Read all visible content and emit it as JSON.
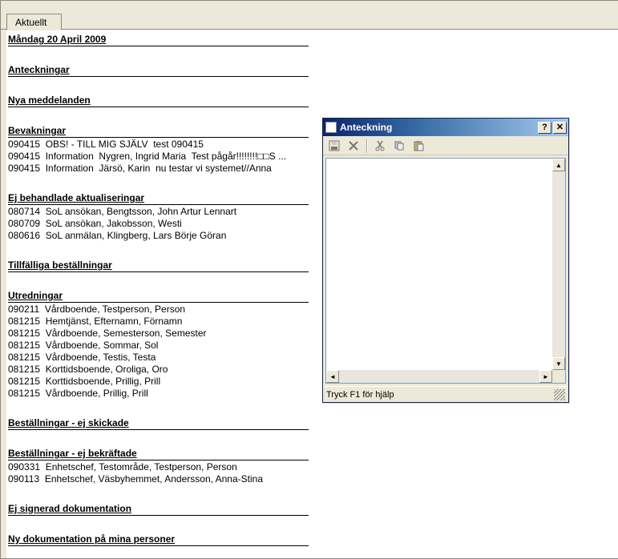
{
  "tab": {
    "label": "Aktuellt"
  },
  "date_heading": "Måndag 20 April 2009",
  "sections": {
    "anteckningar": {
      "title": "Anteckningar"
    },
    "nya_meddelanden": {
      "title": "Nya meddelanden"
    },
    "bevakningar": {
      "title": "Bevakningar",
      "items": [
        {
          "date": "090415",
          "text": "OBS! - TILL MIG SJÄLV  test 090415"
        },
        {
          "date": "090415",
          "text": "Information  Nygren, Ingrid Maria  Test pågår!!!!!!!!□□S ..."
        },
        {
          "date": "090415",
          "text": "Information  Järsö, Karin  nu testar vi systemet//Anna"
        }
      ]
    },
    "ej_behandlade": {
      "title": "Ej behandlade aktualiseringar",
      "items": [
        {
          "date": "080714",
          "text": "SoL ansökan, Bengtsson, John Artur Lennart"
        },
        {
          "date": "080709",
          "text": "SoL ansökan, Jakobsson, Westi"
        },
        {
          "date": "080616",
          "text": "SoL anmälan, Klingberg, Lars Börje Göran"
        }
      ]
    },
    "tillfalliga": {
      "title": "Tillfälliga beställningar"
    },
    "utredningar": {
      "title": "Utredningar",
      "items": [
        {
          "date": "090211",
          "text": "Vårdboende, Testperson, Person"
        },
        {
          "date": "081215",
          "text": "Hemtjänst, Efternamn, Förnamn"
        },
        {
          "date": "081215",
          "text": "Vårdboende, Semesterson, Semester"
        },
        {
          "date": "081215",
          "text": "Vårdboende, Sommar, Sol"
        },
        {
          "date": "081215",
          "text": "Vårdboende, Testis, Testa"
        },
        {
          "date": "081215",
          "text": "Korttidsboende, Oroliga, Oro"
        },
        {
          "date": "081215",
          "text": "Korttidsboende, Prillig, Prill"
        },
        {
          "date": "081215",
          "text": "Vårdboende, Prillig, Prill"
        }
      ]
    },
    "ej_skickade": {
      "title": "Beställningar - ej skickade"
    },
    "ej_bekraftade": {
      "title": "Beställningar - ej bekräftade",
      "items": [
        {
          "date": "090331",
          "text": "Enhetschef, Testområde, Testperson, Person"
        },
        {
          "date": "090113",
          "text": "Enhetschef, Väsbyhemmet, Andersson, Anna-Stina"
        }
      ]
    },
    "ej_signerad": {
      "title": "Ej signerad dokumentation"
    },
    "ny_dok": {
      "title": "Ny dokumentation på mina personer"
    }
  },
  "dialog": {
    "title": "Anteckning",
    "help": "?",
    "close": "✕",
    "status": "Tryck F1 för hjälp",
    "toolbar": {
      "save": "save-icon",
      "delete": "delete-icon",
      "cut": "cut-icon",
      "copy": "copy-icon",
      "paste": "paste-icon"
    }
  }
}
